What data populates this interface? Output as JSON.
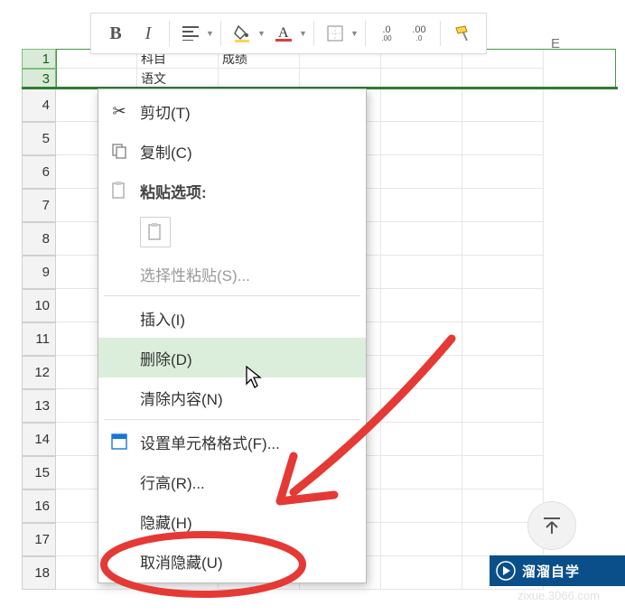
{
  "toolbar": {
    "bold": "B",
    "italic": "I"
  },
  "columns": {
    "E": "E"
  },
  "row_numbers": [
    "1",
    "3",
    "4",
    "5",
    "6",
    "7",
    "8",
    "9",
    "10",
    "11",
    "12",
    "13",
    "14",
    "15",
    "16",
    "17",
    "18"
  ],
  "selected_rows": [
    "1",
    "3"
  ],
  "visible_cells": {
    "r1c2": "科目",
    "r1c3": "成绩",
    "r3c2": "语文"
  },
  "context_menu": {
    "cut": "剪切(T)",
    "copy": "复制(C)",
    "paste_options": "粘贴选项:",
    "paste_special": "选择性粘贴(S)...",
    "insert": "插入(I)",
    "delete": "删除(D)",
    "clear": "清除内容(N)",
    "format_cells": "设置单元格格式(F)...",
    "row_height": "行高(R)...",
    "hide": "隐藏(H)",
    "unhide": "取消隐藏(U)"
  },
  "badge": {
    "brand": "溜溜自学",
    "sub": "zixue.3066.com"
  }
}
